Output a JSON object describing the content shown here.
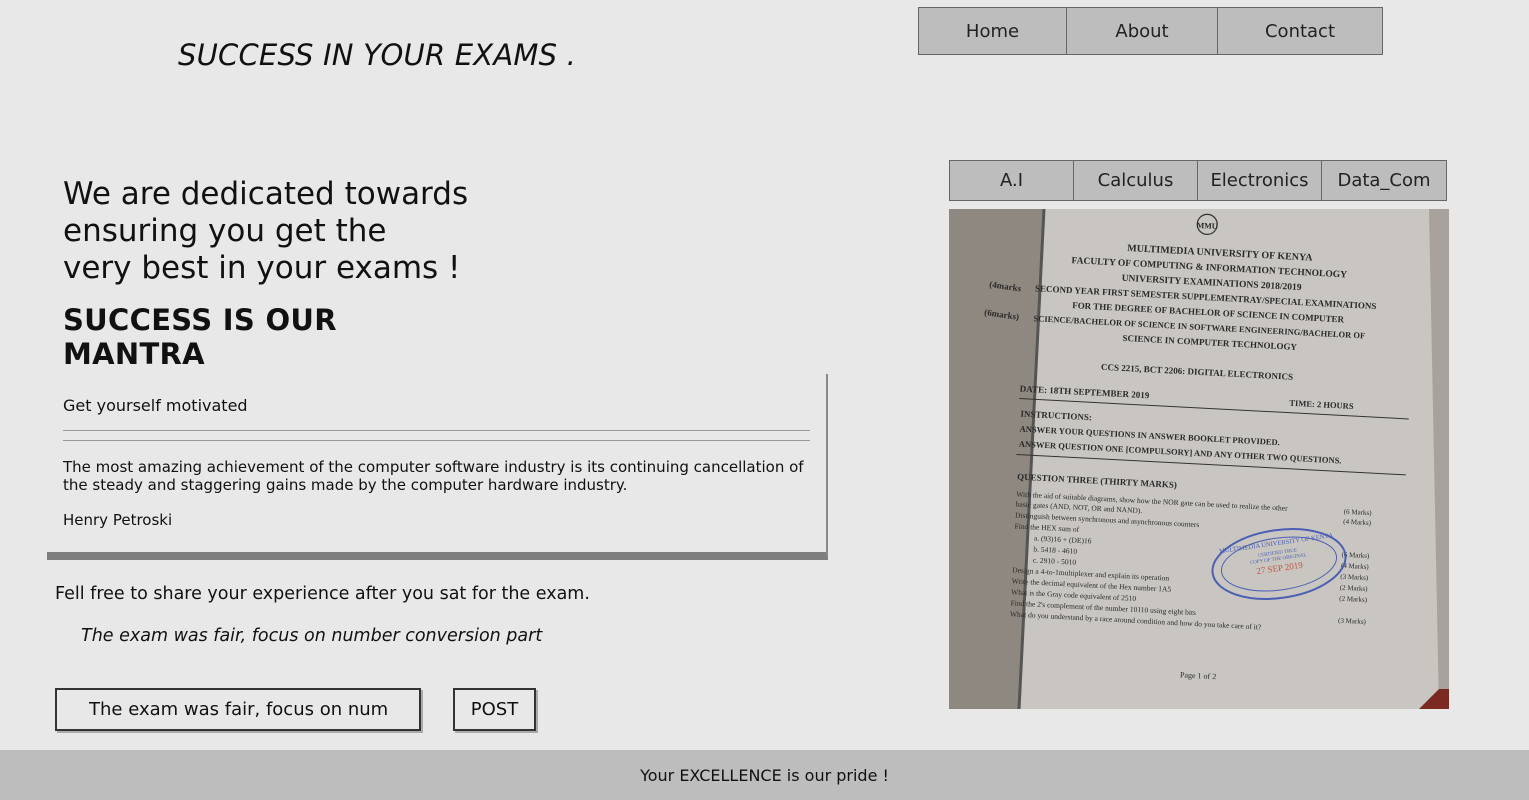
{
  "header": {
    "site_title": "SUCCESS IN YOUR EXAMS ."
  },
  "top_nav": [
    {
      "label": "Home"
    },
    {
      "label": "About"
    },
    {
      "label": "Contact"
    }
  ],
  "hero": {
    "line1": "We are dedicated towards",
    "line2": "ensuring you get the",
    "line3": "very best in your exams !",
    "motto": "SUCCESS IS OUR MANTRA"
  },
  "quote_card": {
    "heading": "Get yourself motivated",
    "text": "The most amazing achievement of the computer software industry is its continuing cancellation of the steady and staggering gains made by the computer hardware industry.",
    "author": "Henry Petroski"
  },
  "comments": {
    "prompt": "Fell free to share your experience after you sat for the exam.",
    "posted": "The exam was fair, focus on number conversion part",
    "input_value": "The exam was fair, focus on number conversion part",
    "post_label": "POST"
  },
  "subject_nav": [
    {
      "label": "A.I"
    },
    {
      "label": "Calculus"
    },
    {
      "label": "Electronics"
    },
    {
      "label": "Data_Com"
    }
  ],
  "exam_paper": {
    "logo": "MMU",
    "university": "MULTIMEDIA UNIVERSITY OF KENYA",
    "faculty": "FACULTY OF COMPUTING & INFORMATION TECHNOLOGY",
    "exams": "UNIVERSITY EXAMINATIONS 2018/2019",
    "semester": "SECOND YEAR FIRST SEMESTER SUPPLEMENTRAY/SPECIAL EXAMINATIONS",
    "degree1": "FOR THE DEGREE OF BACHELOR OF SCIENCE IN COMPUTER",
    "degree2": "SCIENCE/BACHELOR OF SCIENCE IN SOFTWARE ENGINEERING/BACHELOR OF",
    "degree3": "SCIENCE IN COMPUTER TECHNOLOGY",
    "course": "CCS 2215, BCT 2206:   DIGITAL ELECTRONICS",
    "date": "DATE: 18TH SEPTEMBER 2019",
    "time": "TIME: 2 HOURS",
    "instructions": "INSTRUCTIONS:",
    "instr1": "ANSWER YOUR QUESTIONS IN ANSWER BOOKLET PROVIDED.",
    "instr2": "ANSWER QUESTION ONE [COMPULSORY] AND ANY OTHER TWO QUESTIONS.",
    "section": "QUESTION THREE (THIRTY MARKS)",
    "q1": "With the aid of suitable diagrams, show how the NOR gate can be used to realize the other",
    "q1b": "basic gates (AND, NOT, OR and NAND).",
    "q2": "Distinguish between synchronous and asynchronous counters",
    "q3": "Find the HEX sum of",
    "q3a": "a.   (93)16 + (DE)16",
    "q3b": "b.   5418 - 4610",
    "q3c": "c.   2910 - 5010",
    "q4": "Design a 4-to-1multiplexer and explain its operation",
    "q5": "Write the decimal equivalent of the Hex number 1A5",
    "q6": "What is the Gray  code equivalent of 2510",
    "q7": "Find the 2's complement of the number 10110 using eight bits",
    "q8": "What do you understand by a race around condition and how do you take care of it?",
    "marks": [
      "(6 Marks)",
      "(4 Marks)",
      "(6 Marks)",
      "(4 Marks)",
      "(3 Marks)",
      "(2 Marks)",
      "(2 Marks)",
      "(3 Marks)"
    ],
    "margin_marks": [
      "(4marks",
      "(6marks)"
    ],
    "stamp_top": "MULTIMEDIA UNIVERSITY OF KENYA",
    "stamp_date": "27 SEP 2019",
    "stamp_line1": "CERTIFIED TRUE",
    "stamp_line2": "COPY OF THE ORIGINAL",
    "page": "Page 1 of 2"
  },
  "footer": {
    "text": "Your EXCELLENCE is our pride !"
  },
  "colors": {
    "background": "#e8e8e8",
    "nav_button": "#bdbdbd",
    "footer": "#bdbdbd",
    "stamp": "#4a5fb5"
  }
}
